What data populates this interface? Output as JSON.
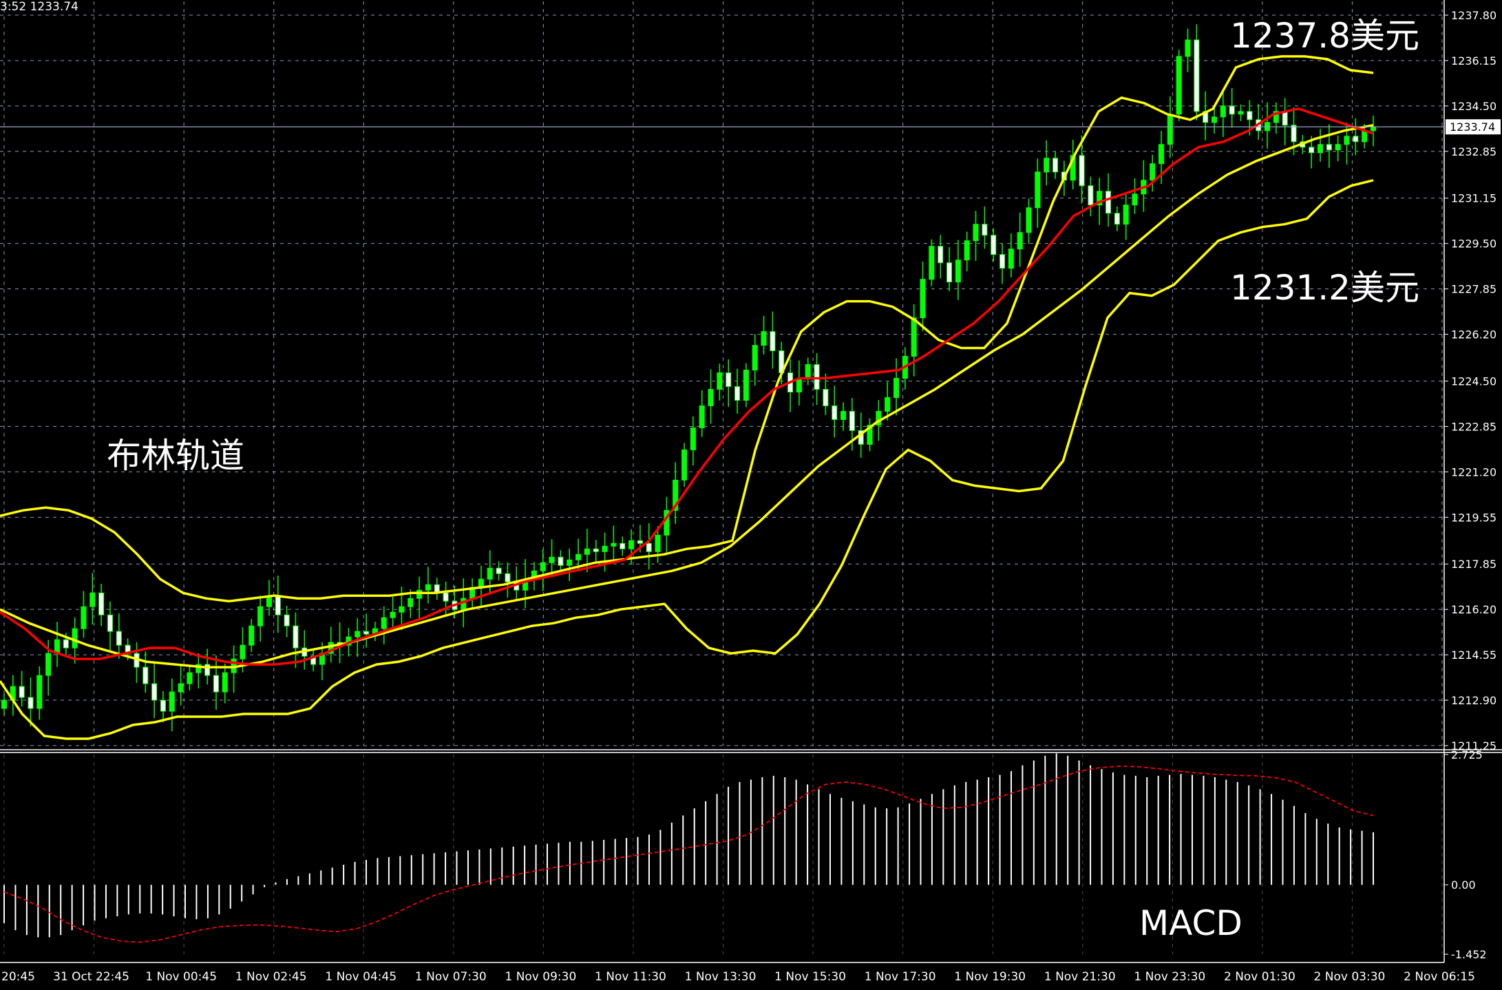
{
  "header": {
    "text": "3:52 1233.74"
  },
  "annotations": {
    "upper_price": "1237.8美元",
    "lower_price": "1231.2美元",
    "bollinger": "布林轨道",
    "macd": "MACD"
  },
  "colors": {
    "background": "#000000",
    "grid": "#8a9bb8",
    "bull_body": "#00ff00",
    "bear_body": "#ffffff",
    "wick": "#00ff00",
    "bollinger": "#ffff00",
    "ma_red": "#ff0000",
    "macd_hist": "#ffffff",
    "macd_signal": "#ff0000",
    "axis_text": "#ffffff"
  },
  "chart_data": [
    {
      "type": "candlestick",
      "title": "",
      "current_price": "1233.74",
      "ylim": [
        1211.25,
        1237.8
      ],
      "y_ticks": [
        "1237.80",
        "1236.15",
        "1234.50",
        "1232.85",
        "1231.15",
        "1229.50",
        "1227.85",
        "1226.20",
        "1224.50",
        "1222.85",
        "1221.20",
        "1219.55",
        "1217.85",
        "1216.20",
        "1214.55",
        "1212.90",
        "1211.25"
      ],
      "x_ticks": [
        "20:45",
        "31 Oct 22:45",
        "1 Nov 00:45",
        "1 Nov 02:45",
        "1 Nov 04:45",
        "1 Nov 07:30",
        "1 Nov 09:30",
        "1 Nov 11:30",
        "1 Nov 13:30",
        "1 Nov 15:30",
        "1 Nov 17:30",
        "1 Nov 19:30",
        "1 Nov 21:30",
        "1 Nov 23:30",
        "2 Nov 01:30",
        "2 Nov 03:30",
        "2 Nov 06:15"
      ],
      "closes": [
        1212.9,
        1213.4,
        1213.0,
        1212.6,
        1213.8,
        1214.6,
        1215.1,
        1214.8,
        1215.5,
        1216.3,
        1216.8,
        1216.0,
        1215.4,
        1214.9,
        1214.6,
        1214.1,
        1213.5,
        1212.9,
        1212.5,
        1213.2,
        1213.5,
        1213.9,
        1214.2,
        1213.8,
        1213.2,
        1213.9,
        1214.4,
        1214.9,
        1215.6,
        1216.3,
        1216.7,
        1216.0,
        1215.6,
        1214.8,
        1214.5,
        1214.2,
        1214.6,
        1215.0,
        1214.9,
        1215.2,
        1215.4,
        1215.3,
        1215.5,
        1215.9,
        1216.1,
        1216.3,
        1216.6,
        1216.9,
        1217.1,
        1216.8,
        1216.5,
        1216.2,
        1216.6,
        1217.0,
        1217.3,
        1217.7,
        1217.5,
        1217.2,
        1216.9,
        1217.3,
        1217.6,
        1217.9,
        1218.1,
        1217.8,
        1218.0,
        1218.2,
        1218.4,
        1218.3,
        1218.5,
        1218.6,
        1218.4,
        1218.7,
        1218.6,
        1218.3,
        1218.9,
        1219.8,
        1220.9,
        1222.0,
        1222.8,
        1223.6,
        1224.2,
        1224.8,
        1224.3,
        1223.8,
        1224.9,
        1225.8,
        1226.3,
        1225.6,
        1224.8,
        1224.1,
        1224.6,
        1225.1,
        1224.2,
        1223.6,
        1223.1,
        1223.4,
        1222.7,
        1222.2,
        1222.9,
        1223.4,
        1223.9,
        1224.6,
        1225.4,
        1226.8,
        1228.2,
        1229.4,
        1228.8,
        1228.1,
        1228.9,
        1229.6,
        1230.2,
        1229.8,
        1229.1,
        1228.6,
        1229.3,
        1229.9,
        1230.8,
        1232.1,
        1232.6,
        1232.1,
        1231.8,
        1232.7,
        1231.6,
        1230.9,
        1231.4,
        1230.6,
        1230.2,
        1230.9,
        1231.3,
        1231.8,
        1232.4,
        1233.1,
        1234.2,
        1236.3,
        1236.9,
        1234.3,
        1233.9,
        1234.1,
        1234.5,
        1234.2,
        1234.3,
        1234.0,
        1233.6,
        1233.9,
        1234.3,
        1233.8,
        1233.2,
        1233.0,
        1232.8,
        1233.1,
        1232.9,
        1233.1,
        1233.4,
        1233.2,
        1233.6,
        1233.74
      ],
      "bollinger_upper": [
        1219.6,
        1219.8,
        1219.9,
        1219.8,
        1219.5,
        1219.0,
        1218.2,
        1217.3,
        1216.8,
        1216.6,
        1216.5,
        1216.6,
        1216.7,
        1216.6,
        1216.6,
        1216.7,
        1216.7,
        1216.7,
        1216.8,
        1216.8,
        1216.9,
        1217.0,
        1217.1,
        1217.3,
        1217.5,
        1217.7,
        1217.9,
        1218.0,
        1218.1,
        1218.2,
        1218.4,
        1218.5,
        1218.7,
        1222.0,
        1224.5,
        1226.3,
        1227.0,
        1227.4,
        1227.4,
        1227.2,
        1226.7,
        1226.0,
        1225.7,
        1225.7,
        1226.6,
        1228.8,
        1231.0,
        1232.8,
        1234.3,
        1234.8,
        1234.6,
        1234.2,
        1234.0,
        1234.4,
        1235.9,
        1236.2,
        1236.3,
        1236.3,
        1236.2,
        1235.8,
        1235.7
      ],
      "bollinger_lower": [
        1213.6,
        1212.4,
        1211.6,
        1211.5,
        1211.5,
        1211.7,
        1212.0,
        1212.1,
        1212.3,
        1212.3,
        1212.3,
        1212.4,
        1212.4,
        1212.4,
        1212.6,
        1213.4,
        1213.9,
        1214.2,
        1214.3,
        1214.5,
        1214.8,
        1215.0,
        1215.2,
        1215.4,
        1215.6,
        1215.7,
        1215.9,
        1216.0,
        1216.2,
        1216.3,
        1216.4,
        1215.5,
        1214.8,
        1214.6,
        1214.7,
        1214.6,
        1215.3,
        1216.4,
        1217.8,
        1219.6,
        1221.3,
        1222.0,
        1221.6,
        1220.9,
        1220.7,
        1220.6,
        1220.5,
        1220.6,
        1221.6,
        1224.3,
        1226.8,
        1227.7,
        1227.6,
        1228.0,
        1228.8,
        1229.6,
        1229.9,
        1230.1,
        1230.2,
        1230.4,
        1231.2,
        1231.6,
        1231.8
      ],
      "ma_red": [
        1216.1,
        1215.5,
        1214.7,
        1214.4,
        1214.4,
        1214.6,
        1214.8,
        1214.8,
        1214.5,
        1214.3,
        1214.2,
        1214.2,
        1214.3,
        1214.6,
        1215.0,
        1215.3,
        1215.6,
        1215.9,
        1216.3,
        1216.6,
        1216.9,
        1217.2,
        1217.4,
        1217.6,
        1217.8,
        1218.0,
        1218.7,
        1219.9,
        1221.2,
        1222.4,
        1223.4,
        1224.2,
        1224.6,
        1224.6,
        1224.7,
        1224.8,
        1224.9,
        1225.4,
        1226.0,
        1226.6,
        1227.4,
        1228.4,
        1229.4,
        1230.5,
        1231.0,
        1231.3,
        1231.6,
        1232.4,
        1233.0,
        1233.2,
        1233.6,
        1234.2,
        1234.4,
        1234.1,
        1233.8,
        1233.5
      ],
      "ma_yellow": [
        1216.2,
        1215.7,
        1215.3,
        1214.9,
        1214.6,
        1214.3,
        1214.2,
        1214.1,
        1214.1,
        1214.3,
        1214.6,
        1214.8,
        1215.0,
        1215.3,
        1215.6,
        1215.9,
        1216.2,
        1216.4,
        1216.6,
        1216.8,
        1217.0,
        1217.2,
        1217.4,
        1217.6,
        1217.9,
        1218.5,
        1219.4,
        1220.4,
        1221.4,
        1222.2,
        1223.0,
        1223.6,
        1224.2,
        1224.9,
        1225.6,
        1226.2,
        1227.0,
        1227.8,
        1228.7,
        1229.6,
        1230.5,
        1231.3,
        1232.0,
        1232.5,
        1232.9,
        1233.3,
        1233.6,
        1233.8
      ],
      "macd_scale": {
        "top_label": "2.725",
        "zero_label": "0.00",
        "bottom_label": "-1.452",
        "ylim": [
          -1.452,
          2.725
        ]
      },
      "macd_hist": [
        -0.8,
        -0.95,
        -1.05,
        -1.1,
        -1.1,
        -1.05,
        -0.95,
        -0.85,
        -0.75,
        -0.7,
        -0.66,
        -0.62,
        -0.6,
        -0.6,
        -0.62,
        -0.66,
        -0.7,
        -0.72,
        -0.7,
        -0.62,
        -0.5,
        -0.35,
        -0.2,
        -0.05,
        0.05,
        0.12,
        0.18,
        0.24,
        0.3,
        0.36,
        0.42,
        0.48,
        0.52,
        0.56,
        0.58,
        0.6,
        0.62,
        0.64,
        0.66,
        0.68,
        0.7,
        0.72,
        0.74,
        0.76,
        0.78,
        0.8,
        0.82,
        0.84,
        0.86,
        0.88,
        0.9,
        0.9,
        0.92,
        0.94,
        0.96,
        0.98,
        1.0,
        1.05,
        1.15,
        1.3,
        1.45,
        1.6,
        1.75,
        1.9,
        2.05,
        2.15,
        2.2,
        2.25,
        2.28,
        2.25,
        2.2,
        2.1,
        2.0,
        1.9,
        1.82,
        1.75,
        1.68,
        1.62,
        1.6,
        1.62,
        1.7,
        1.8,
        1.9,
        2.0,
        2.08,
        2.15,
        2.2,
        2.25,
        2.3,
        2.38,
        2.5,
        2.6,
        2.7,
        2.75,
        2.7,
        2.6,
        2.5,
        2.42,
        2.35,
        2.3,
        2.28,
        2.25,
        2.28,
        2.3,
        2.32,
        2.3,
        2.28,
        2.25,
        2.2,
        2.15,
        2.08,
        2.0,
        1.9,
        1.78,
        1.65,
        1.5,
        1.38,
        1.28,
        1.2,
        1.16,
        1.13,
        1.1
      ],
      "macd_signal": [
        -0.15,
        -0.3,
        -0.5,
        -0.75,
        -0.95,
        -1.1,
        -1.18,
        -1.2,
        -1.15,
        -1.05,
        -0.95,
        -0.88,
        -0.85,
        -0.84,
        -0.86,
        -0.9,
        -0.95,
        -0.98,
        -0.92,
        -0.78,
        -0.6,
        -0.4,
        -0.22,
        -0.1,
        0.0,
        0.1,
        0.2,
        0.28,
        0.35,
        0.42,
        0.48,
        0.54,
        0.6,
        0.66,
        0.72,
        0.78,
        0.85,
        0.92,
        1.05,
        1.3,
        1.6,
        1.9,
        2.1,
        2.15,
        2.1,
        2.0,
        1.85,
        1.7,
        1.6,
        1.62,
        1.72,
        1.85,
        1.98,
        2.1,
        2.25,
        2.38,
        2.45,
        2.48,
        2.47,
        2.43,
        2.38,
        2.34,
        2.31,
        2.29,
        2.28,
        2.24,
        2.15,
        1.95,
        1.75,
        1.55,
        1.45
      ]
    }
  ]
}
